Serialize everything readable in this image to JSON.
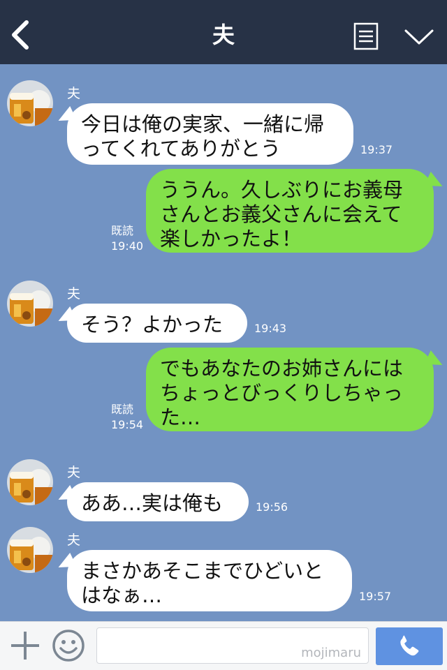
{
  "header": {
    "title": "夫"
  },
  "messages": [
    {
      "side": "in",
      "sender": "夫",
      "text": "今日は俺の実家、一緒に帰ってくれてありがとう",
      "time": "19:37"
    },
    {
      "side": "out",
      "read": "既読",
      "text": "ううん。久しぶりにお義母さんとお義父さんに会えて楽しかったよ！",
      "time": "19:40"
    },
    {
      "side": "in",
      "sender": "夫",
      "text": "そう？よかった",
      "time": "19:43"
    },
    {
      "side": "out",
      "read": "既読",
      "text": "でもあなたのお姉さんにはちょっとびっくりしちゃった…",
      "time": "19:54"
    },
    {
      "side": "in",
      "sender": "夫",
      "text": "ああ…実は俺も",
      "time": "19:56"
    },
    {
      "side": "in",
      "sender": "夫",
      "text": "まさかあそこまでひどいとはなぁ…",
      "time": "19:57"
    }
  ],
  "footer": {
    "watermark": "mojimaru"
  },
  "icons": {
    "back": "chevron-left-icon",
    "menu": "menu-list-icon",
    "expand": "chevron-down-icon",
    "plus": "plus-icon",
    "emoji": "smiley-icon",
    "call": "phone-icon"
  },
  "colors": {
    "header": "#273246",
    "chat_bg": "#7293c3",
    "bubble_in": "#ffffff",
    "bubble_out": "#83e04a",
    "call_button": "#5f92e1"
  }
}
